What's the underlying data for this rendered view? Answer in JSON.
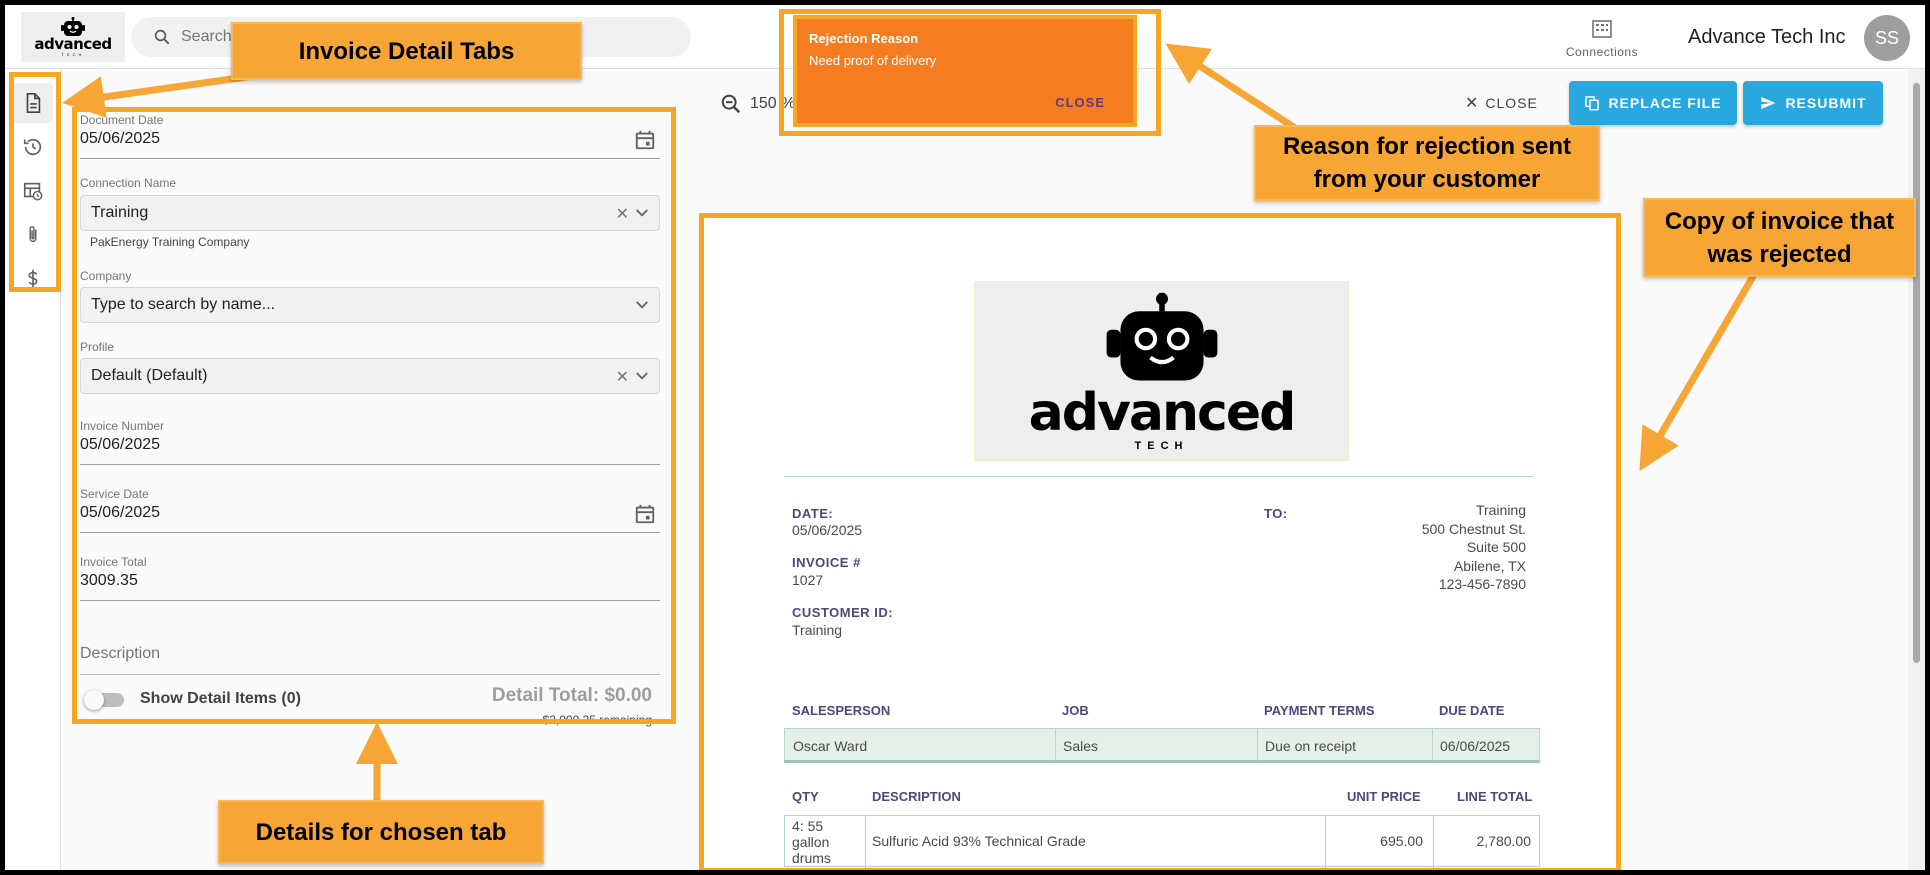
{
  "topbar": {
    "logo_text": "advanced",
    "logo_sub": "TECH",
    "search_placeholder": "Search",
    "connections_label": "Connections",
    "company_name": "Advance Tech Inc",
    "avatar_initials": "SS"
  },
  "rail": {
    "items": [
      {
        "icon": "document-icon",
        "active": true
      },
      {
        "icon": "history-icon",
        "active": false
      },
      {
        "icon": "schedule-table-icon",
        "active": false
      },
      {
        "icon": "paperclip-icon",
        "active": false
      },
      {
        "icon": "dollar-icon",
        "active": false
      }
    ]
  },
  "form": {
    "document_date": {
      "label": "Document Date",
      "value": "05/06/2025"
    },
    "connection": {
      "label": "Connection Name",
      "value": "Training",
      "helper": "PakEnergy Training Company"
    },
    "company": {
      "label": "Company",
      "placeholder": "Type to search by name..."
    },
    "profile": {
      "label": "Profile",
      "value": "Default (Default)"
    },
    "invoice_number": {
      "label": "Invoice Number",
      "value": "05/06/2025"
    },
    "service_date": {
      "label": "Service Date",
      "value": "05/06/2025"
    },
    "invoice_total": {
      "label": "Invoice Total",
      "value": "3009.35"
    },
    "description_label": "Description",
    "show_detail_label": "Show Detail Items (0)",
    "detail_total": "Detail Total: $0.00",
    "remaining": "$3,009.35 remaining"
  },
  "toolbar": {
    "zoom_value": "150 %",
    "close_label": "CLOSE",
    "replace_label": "REPLACE FILE",
    "resubmit_label": "RESUBMIT",
    "accent_color": "#29a8e0"
  },
  "toast": {
    "title": "Rejection Reason",
    "message": "Need proof of delivery",
    "close_label": "CLOSE",
    "color": "#f57c1f"
  },
  "invoice": {
    "logo_text": "advanced",
    "logo_sub": "TECH",
    "date_label": "DATE:",
    "date_value": "05/06/2025",
    "invoice_no_label": "INVOICE #",
    "invoice_no_value": "1027",
    "customer_label": "CUSTOMER ID:",
    "customer_value": "Training",
    "to_label": "TO:",
    "to_lines": [
      "Training",
      "500 Chestnut St.",
      "Suite 500",
      "Abilene, TX",
      "123-456-7890"
    ],
    "sales_headers": [
      "SALESPERSON",
      "JOB",
      "PAYMENT TERMS",
      "DUE DATE"
    ],
    "sales_values": [
      "Oscar Ward",
      "Sales",
      "Due on receipt",
      "06/06/2025"
    ],
    "item_headers": [
      "QTY",
      "DESCRIPTION",
      "UNIT PRICE",
      "LINE TOTAL"
    ],
    "item_row": {
      "qty": "4: 55 gallon drums",
      "description": "Sulfuric Acid 93% Technical Grade",
      "unit_price": "695.00",
      "line_total": "2,780.00"
    }
  },
  "annotations": {
    "tabs": "Invoice Detail Tabs",
    "reason": "Reason for rejection sent from your customer",
    "copy": "Copy of invoice that was rejected",
    "details": "Details for chosen tab",
    "color": "#f7a535"
  }
}
